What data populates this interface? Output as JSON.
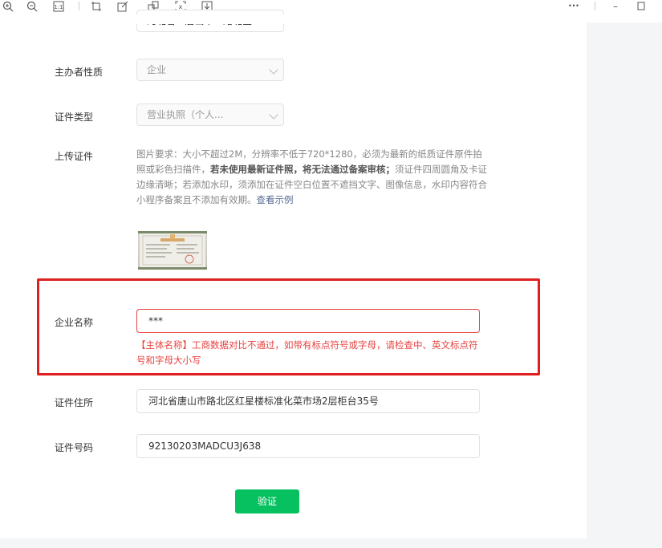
{
  "toolbar": {
    "more_label": "···",
    "minimize_label": "–"
  },
  "form": {
    "region": {
      "value": "河北省 · 唐山市 · 路北区"
    },
    "organizer_type": {
      "label": "主办者性质",
      "value": "企业"
    },
    "cert_type": {
      "label": "证件类型",
      "value": "营业执照（个人..."
    },
    "upload": {
      "label": "上传证件",
      "req_part1": "图片要求：大小不超过2M，分辨率不低于720*1280，必须为最新的纸质证件原件拍照或彩色扫描件，",
      "req_bold": "若未使用最新证件照，将无法通过备案审核；",
      "req_part2": "须证件四周圆角及卡证边缘清晰；若添加水印，须添加在证件空白位置不遮挡文字、图像信息，水印内容符合小程序备案且不添加有效期。",
      "req_link": "查看示例"
    },
    "company_name": {
      "label": "企业名称",
      "value": "***",
      "error": "【主体名称】工商数据对比不通过，如带有标点符号或字母，请检查中、英文标点符号和字母大小写"
    },
    "cert_address": {
      "label": "证件住所",
      "value": "河北省唐山市路北区红星楼标准化菜市场2层柜台35号"
    },
    "cert_number": {
      "label": "证件号码",
      "value": "92130203MADCU3J638"
    },
    "verify_label": "验证"
  },
  "colors": {
    "primary_green": "#07c160",
    "error_red": "#e64340",
    "highlight_red": "#e02020",
    "link_blue": "#576b95"
  }
}
